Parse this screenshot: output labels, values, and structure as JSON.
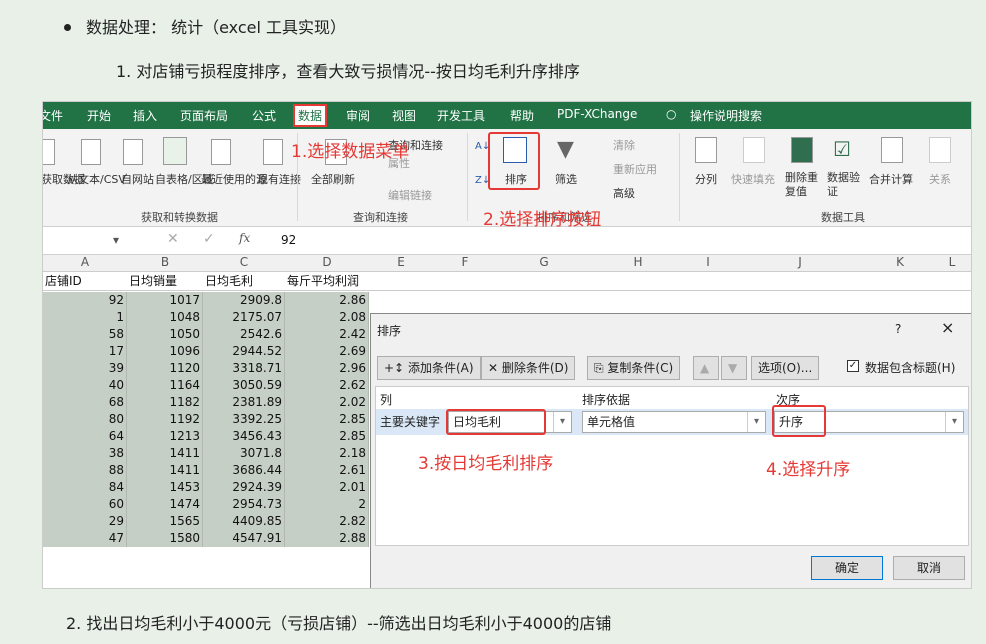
{
  "doc": {
    "bullet": "数据处理： 统计（excel 工具实现）",
    "step1": "1. 对店铺亏损程度排序，查看大致亏损情况--按日均毛利升序排序",
    "step2": "2. 找出日均毛利小于4000元（亏损店铺）--筛选出日均毛利小于4000的店铺"
  },
  "menu": [
    "文件",
    "开始",
    "插入",
    "页面布局",
    "公式",
    "数据",
    "审阅",
    "视图",
    "开发工具",
    "帮助",
    "PDF-XChange",
    "操作说明搜索"
  ],
  "ribbon": {
    "get_data": "获取数据",
    "from_csv": "从文本/CSV",
    "from_web": "自网站",
    "from_table": "自表格/区域",
    "recent": "最近使用的源",
    "existing": "现有连接",
    "group_get": "获取和转换数据",
    "refresh_all": "全部刷新",
    "queries": "查询和连接",
    "properties": "属性",
    "edit_links": "编辑链接",
    "group_query": "查询和连接",
    "sort": "排序",
    "filter": "筛选",
    "clear": "清除",
    "reapply": "重新应用",
    "advanced": "高级",
    "group_sort": "排序和筛选",
    "text_col": "分列",
    "flash_fill": "快速填充",
    "remove_dup": "删除重复值",
    "validation": "数据验证",
    "consolidate": "合并计算",
    "relations": "关系",
    "group_tools": "数据工具"
  },
  "annotations": {
    "a1": "1.选择数据菜单",
    "a2": "2.选择排序按钮",
    "a3": "3.按日均毛利排序",
    "a4": "4.选择升序"
  },
  "formula": {
    "value": "92",
    "fx": "fx"
  },
  "columns": [
    "A",
    "B",
    "C",
    "D",
    "E",
    "F",
    "G",
    "H",
    "I",
    "J",
    "K",
    "L"
  ],
  "headers": [
    "店铺ID",
    "日均销量",
    "日均毛利",
    "每斤平均利润"
  ],
  "rows": [
    [
      "92",
      "1017",
      "2909.8",
      "2.86"
    ],
    [
      "1",
      "1048",
      "2175.07",
      "2.08"
    ],
    [
      "58",
      "1050",
      "2542.6",
      "2.42"
    ],
    [
      "17",
      "1096",
      "2944.52",
      "2.69"
    ],
    [
      "39",
      "1120",
      "3318.71",
      "2.96"
    ],
    [
      "40",
      "1164",
      "3050.59",
      "2.62"
    ],
    [
      "68",
      "1182",
      "2381.89",
      "2.02"
    ],
    [
      "80",
      "1192",
      "3392.25",
      "2.85"
    ],
    [
      "64",
      "1213",
      "3456.43",
      "2.85"
    ],
    [
      "38",
      "1411",
      "3071.8",
      "2.18"
    ],
    [
      "88",
      "1411",
      "3686.44",
      "2.61"
    ],
    [
      "84",
      "1453",
      "2924.39",
      "2.01"
    ],
    [
      "60",
      "1474",
      "2954.73",
      "2"
    ],
    [
      "29",
      "1565",
      "4409.85",
      "2.82"
    ],
    [
      "47",
      "1580",
      "4547.91",
      "2.88"
    ]
  ],
  "dialog": {
    "title": "排序",
    "help": "?",
    "close": "×",
    "add": "添加条件(A)",
    "delete": "删除条件(D)",
    "copy": "复制条件(C)",
    "options": "选项(O)...",
    "header_check": "数据包含标题(H)",
    "col_head": "列",
    "basis_head": "排序依据",
    "order_head": "次序",
    "key_label": "主要关键字",
    "key_value": "日均毛利",
    "basis_value": "单元格值",
    "order_value": "升序",
    "ok": "确定",
    "cancel": "取消"
  }
}
